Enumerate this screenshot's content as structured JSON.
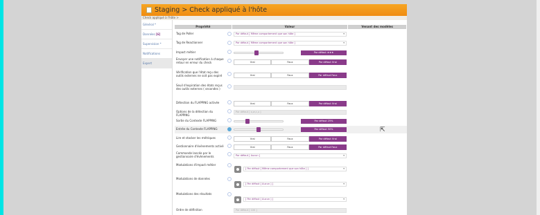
{
  "window": {
    "title": "Staging > Check appliqué à l'hôte",
    "breadcrumb": "Check appliqué à l'hôte >"
  },
  "sidebar": {
    "items": [
      {
        "label": "Général *",
        "badge": ""
      },
      {
        "label": "Données ",
        "badge": "[6]"
      },
      {
        "label": "Supervision *",
        "badge": ""
      },
      {
        "label": "Notifications",
        "badge": ""
      },
      {
        "label": "Expert",
        "badge": ""
      }
    ]
  },
  "table": {
    "headers": [
      "Propriété",
      "Valeur",
      "Venant des modèles"
    ]
  },
  "rows": {
    "poller_tag": {
      "label": "Tag de Poller",
      "value": "Par défaut [ Même comportement que son hôte ]"
    },
    "reactionner_tag": {
      "label": "Tag de Reactionner",
      "value": "Par défaut [ Même comportement que son hôte ]"
    },
    "business_impact": {
      "label": "Impact métier",
      "slider_level": 0.45,
      "button": "Par défaut ★★★"
    },
    "notify_on_check": {
      "label": "Envoyer une notification à chaque retour en erreur du check",
      "options": [
        "Vrai",
        "Faux",
        "Par défaut Vrai"
      ],
      "selected": 2
    },
    "freshness_check": {
      "label": "Vérification que l'état reçu des outils externes ne soit pas expiré",
      "options": [
        "Vrai",
        "Faux",
        "Par défaut Faux"
      ],
      "selected": 2
    },
    "freshness_threshold": {
      "label": "Seuil d'expiration des états reçus des outils externes ( secondes )",
      "value": ""
    },
    "flapping_detection": {
      "label": "Détection du FLAPPING activée",
      "options": [
        "Vrai",
        "Faux",
        "Par défaut Vrai"
      ],
      "selected": 2
    },
    "flapping_options": {
      "label": "Options de la détection du FLAPPING",
      "value": "Par défaut [ o,w,c,u ]"
    },
    "flapping_low": {
      "label": "Sortie du Contexte FLAPPING",
      "slider_level": 0.25,
      "button": "Par défaut 25%"
    },
    "flapping_high": {
      "label": "Entrée du Contexte FLAPPING",
      "slider_level": 0.5,
      "button": "Par défaut 50%"
    },
    "process_perf_data": {
      "label": "Lire et stocker les métriques",
      "options": [
        "Vrai",
        "Faux",
        "Par défaut Vrai"
      ],
      "selected": 2
    },
    "event_handler_enabled": {
      "label": "Gestionnaire d'évènements activé",
      "options": [
        "Vrai",
        "Faux",
        "Par défaut Faux"
      ],
      "selected": 2
    },
    "event_handler_cmd": {
      "label": "Commande lancée par le gestionnaire d'évènements",
      "value": "Par défaut [ Aucun ]"
    },
    "business_impact_mod": {
      "label": "Modulations d'impact métier",
      "value": "[ Par défaut [ Même comportement que son hôte ] ]"
    },
    "data_mod": {
      "label": "Modulations de données",
      "value": "[ Par défaut [ Aucun ] ]"
    },
    "result_mod": {
      "label": "Modulations des résultats",
      "value": "[ Par défaut [ Aucun ] ]"
    },
    "default_order": {
      "label": "Ordre de définition",
      "value": "Par défaut [ 100 ]"
    }
  },
  "colors": {
    "accent": "#8a3b8a",
    "title_bar": "#f08c10",
    "help_active": "#5aa8d8"
  }
}
